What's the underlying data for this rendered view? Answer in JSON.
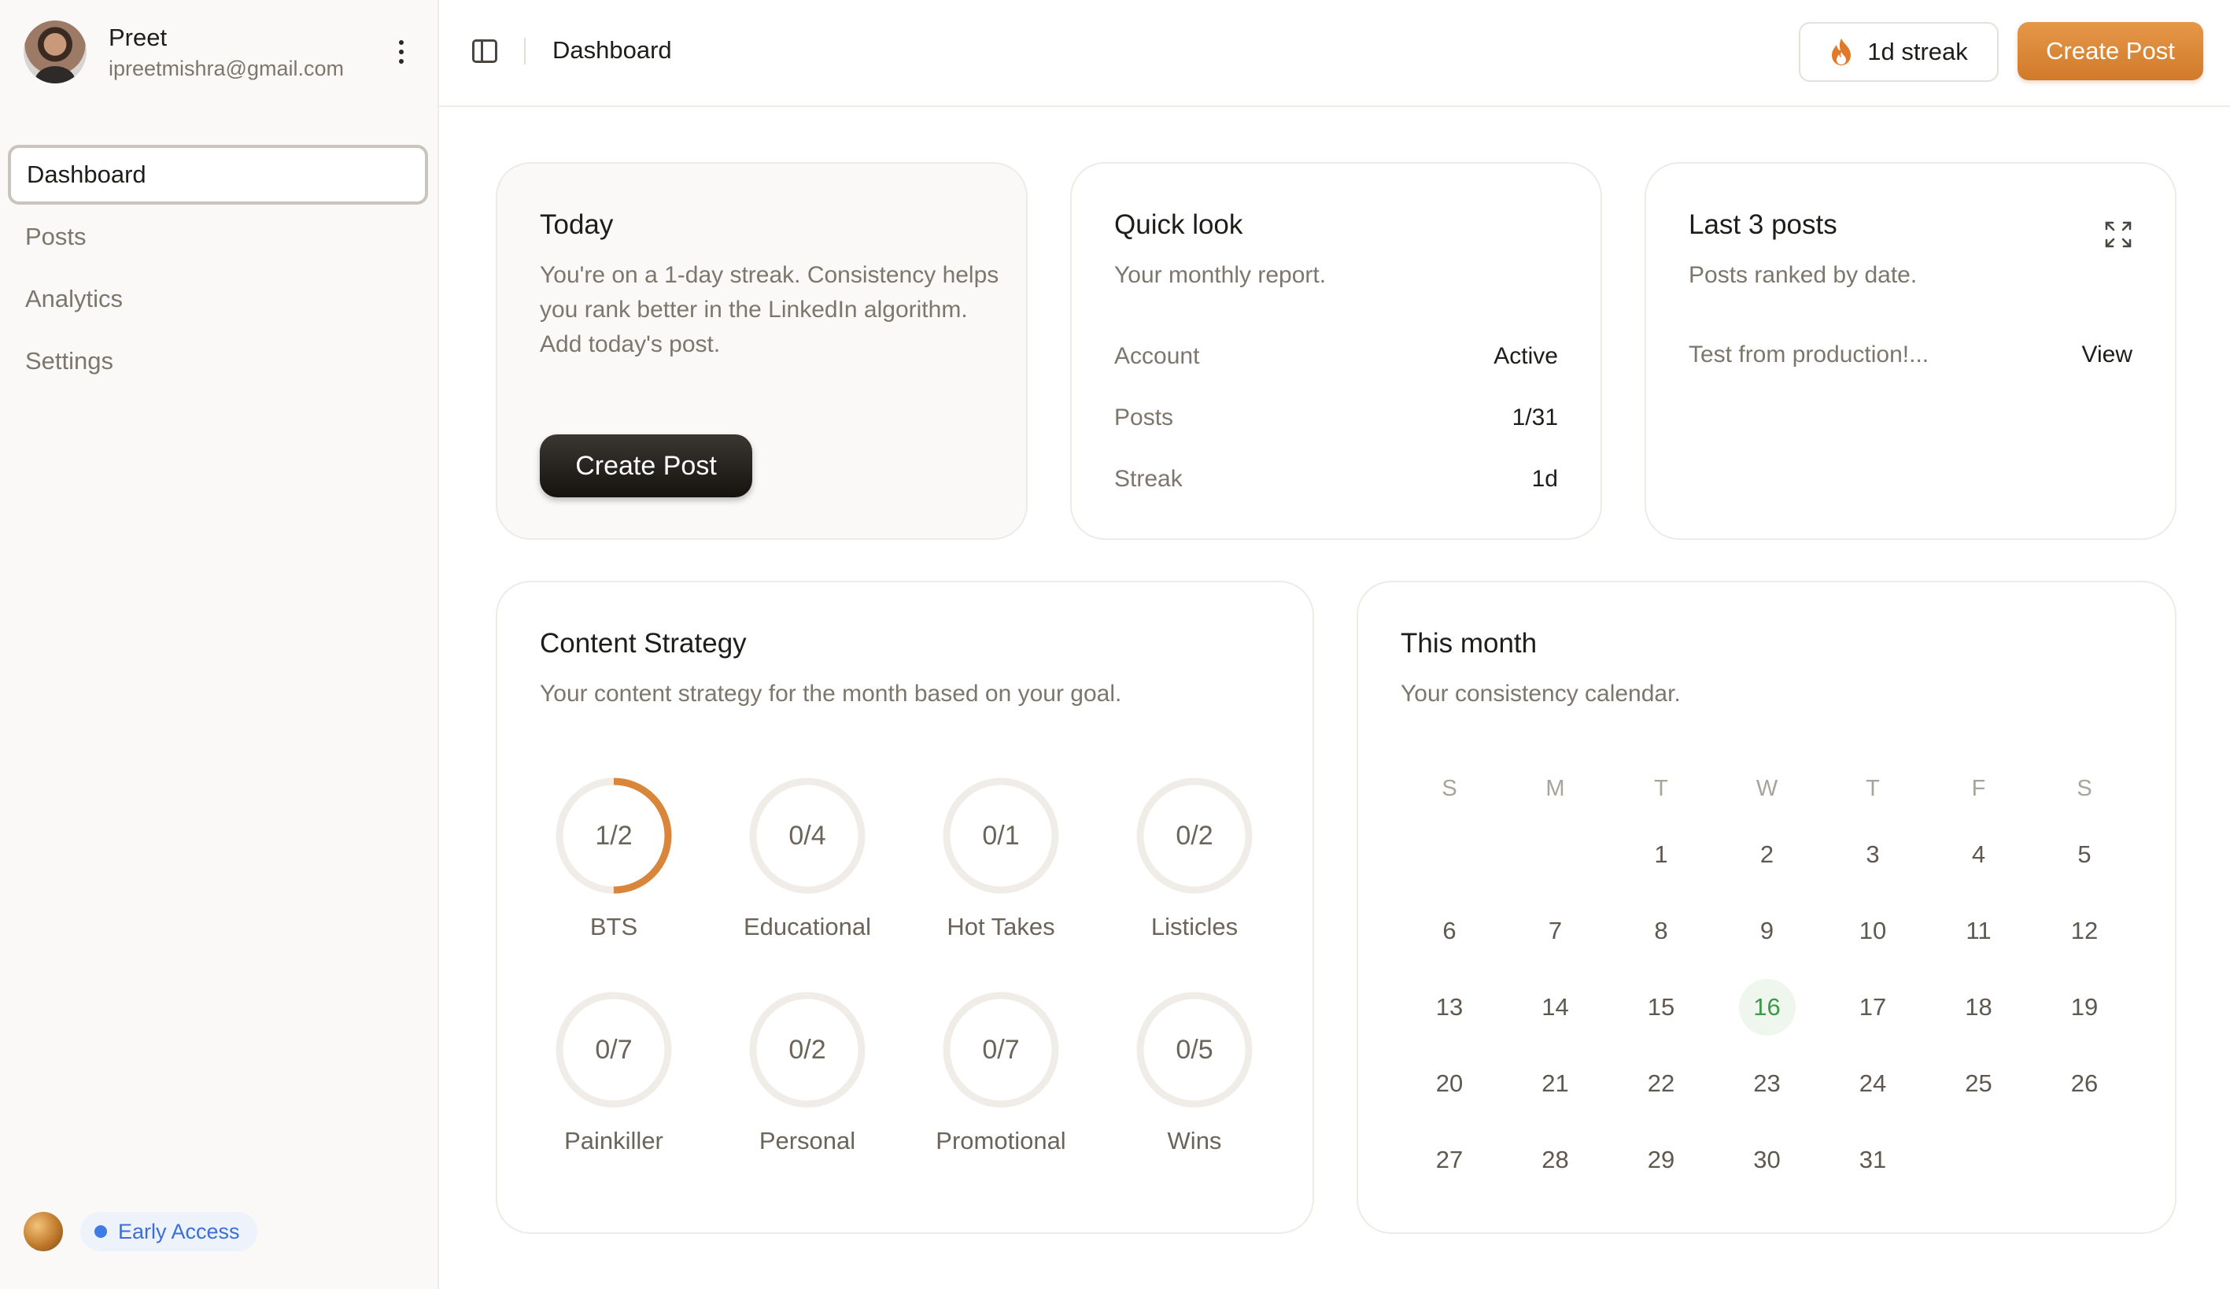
{
  "user": {
    "name": "Preet",
    "email": "ipreetmishra@gmail.com"
  },
  "nav": [
    {
      "label": "Dashboard",
      "active": true
    },
    {
      "label": "Posts",
      "active": false
    },
    {
      "label": "Analytics",
      "active": false
    },
    {
      "label": "Settings",
      "active": false
    }
  ],
  "badge": {
    "label": "Early Access"
  },
  "topbar": {
    "title": "Dashboard",
    "streak_label": "1d streak",
    "create_label": "Create Post"
  },
  "today": {
    "title": "Today",
    "text": "You're on a 1-day streak. Consistency helps you rank better in the LinkedIn algorithm. Add today's post.",
    "button": "Create Post"
  },
  "quick": {
    "title": "Quick look",
    "subtitle": "Your monthly report.",
    "rows": [
      {
        "key": "Account",
        "value": "Active"
      },
      {
        "key": "Posts",
        "value": "1/31"
      },
      {
        "key": "Streak",
        "value": "1d"
      }
    ]
  },
  "last": {
    "title": "Last 3 posts",
    "subtitle": "Posts ranked by date.",
    "posts": [
      {
        "title": "Test from production!...",
        "action": "View"
      }
    ]
  },
  "strategy": {
    "title": "Content Strategy",
    "subtitle": "Your content strategy for the month based on your goal.",
    "items": [
      {
        "label": "BTS",
        "done": 1,
        "total": 2,
        "text": "1/2"
      },
      {
        "label": "Educational",
        "done": 0,
        "total": 4,
        "text": "0/4"
      },
      {
        "label": "Hot Takes",
        "done": 0,
        "total": 1,
        "text": "0/1"
      },
      {
        "label": "Listicles",
        "done": 0,
        "total": 2,
        "text": "0/2"
      },
      {
        "label": "Painkiller",
        "done": 0,
        "total": 7,
        "text": "0/7"
      },
      {
        "label": "Personal",
        "done": 0,
        "total": 2,
        "text": "0/2"
      },
      {
        "label": "Promotional",
        "done": 0,
        "total": 7,
        "text": "0/7"
      },
      {
        "label": "Wins",
        "done": 0,
        "total": 5,
        "text": "0/5"
      }
    ]
  },
  "month": {
    "title": "This month",
    "subtitle": "Your consistency calendar.",
    "weekdays": [
      "S",
      "M",
      "T",
      "W",
      "T",
      "F",
      "S"
    ],
    "first_weekday_index": 2,
    "days_in_month": 31,
    "today": 16
  },
  "colors": {
    "accent": "#d9853a",
    "ring_track": "#f0ede8",
    "today_green": "#3a9a4a"
  }
}
